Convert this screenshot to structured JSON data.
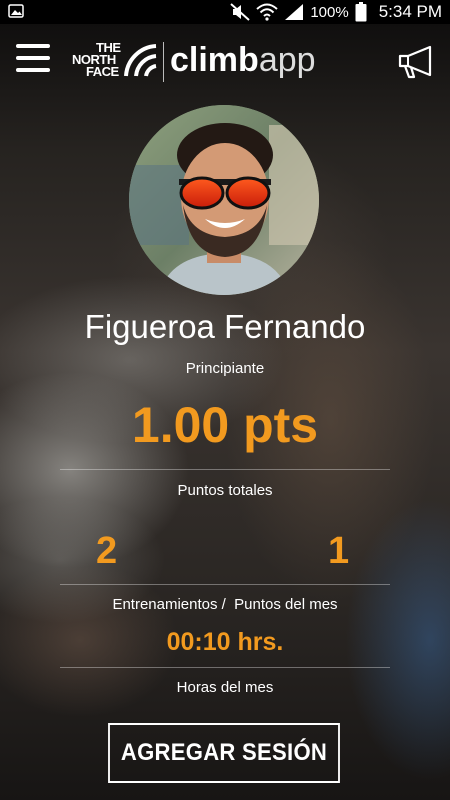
{
  "status_bar": {
    "battery_percent": "100%",
    "time": "5:34 PM",
    "icons": [
      "gallery-icon",
      "mute-icon",
      "wifi-icon",
      "signal-icon",
      "battery-icon"
    ]
  },
  "app_bar": {
    "brand_lines": [
      "THE",
      "NORTH",
      "FACE"
    ],
    "app_name_bold": "climb",
    "app_name_light": "app",
    "menu_icon": "hamburger-menu-icon",
    "announce_icon": "megaphone-icon"
  },
  "profile": {
    "name": "Figueroa Fernando",
    "level": "Principiante"
  },
  "stats": {
    "points": "1.00 pts",
    "points_label": "Puntos totales",
    "trainings": "2",
    "month_points": "1",
    "labels": "Entrenamientos /  Puntos del mes",
    "hours": "00:10 hrs.",
    "hours_label": "Horas del mes"
  },
  "actions": {
    "add_session": "AGREGAR SESIÓN"
  },
  "colors": {
    "accent": "#f29a1f",
    "text": "#ffffff",
    "status_bar_bg": "#000000"
  }
}
